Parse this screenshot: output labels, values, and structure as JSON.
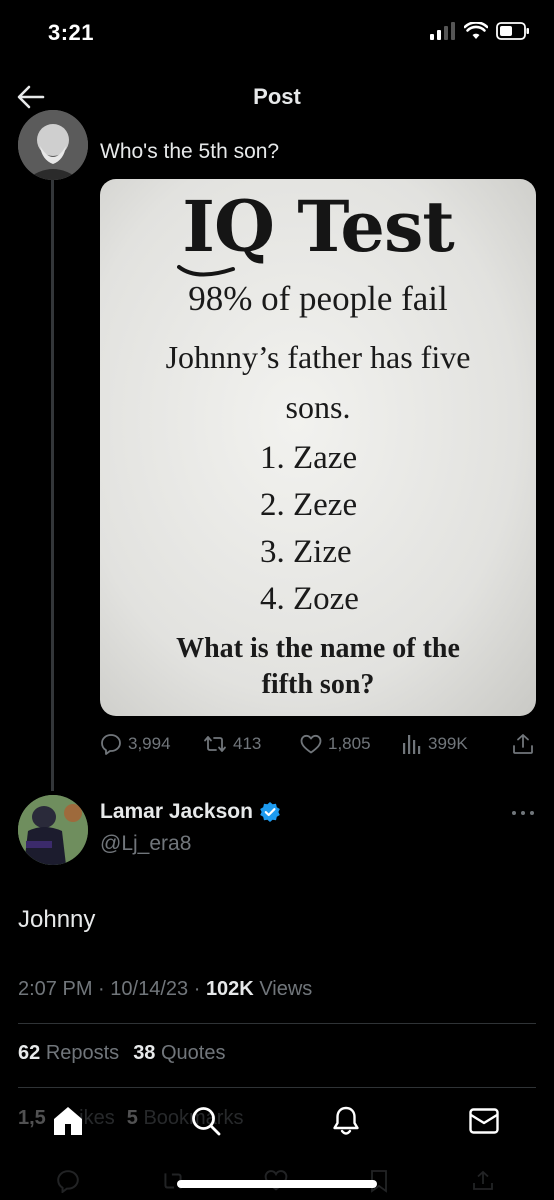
{
  "status_bar": {
    "time": "3:21"
  },
  "nav": {
    "title": "Post"
  },
  "quoted_post": {
    "text": "Who's the 5th son?",
    "image": {
      "title": "IQ Test",
      "subtitle": "98% of people fail",
      "question_line1": "Johnny’s father has five",
      "question_line2": "sons.",
      "list": [
        "1. Zaze",
        "2. Zeze",
        "3. Zize",
        "4. Zoze"
      ],
      "ask_line1": "What is the name of the",
      "ask_line2": "fifth son?"
    },
    "actions": {
      "replies": "3,994",
      "reposts": "413",
      "likes": "1,805",
      "views": "399K"
    }
  },
  "main_post": {
    "display_name": "Lamar Jackson",
    "handle": "@Lj_era8",
    "verified_color": "#1d9bf0",
    "text": "Johnny",
    "time": "2:07 PM",
    "date": "10/14/23",
    "views_count": "102K",
    "views_label": "Views",
    "separator": "·",
    "reposts_count": "62",
    "reposts_label": "Reposts",
    "quotes_count": "38",
    "quotes_label": "Quotes",
    "likes_count": "1,5",
    "likes_label": "Likes",
    "bookmarks_count": "5",
    "bookmarks_label": "Bookmarks"
  },
  "tab_bar": {
    "icons": [
      "home-icon",
      "search-icon",
      "notifications-icon",
      "messages-icon"
    ]
  },
  "colors": {
    "background": "#000000",
    "text_primary": "#e7e9ea",
    "text_secondary": "#71767b",
    "accent": "#1d9bf0"
  }
}
